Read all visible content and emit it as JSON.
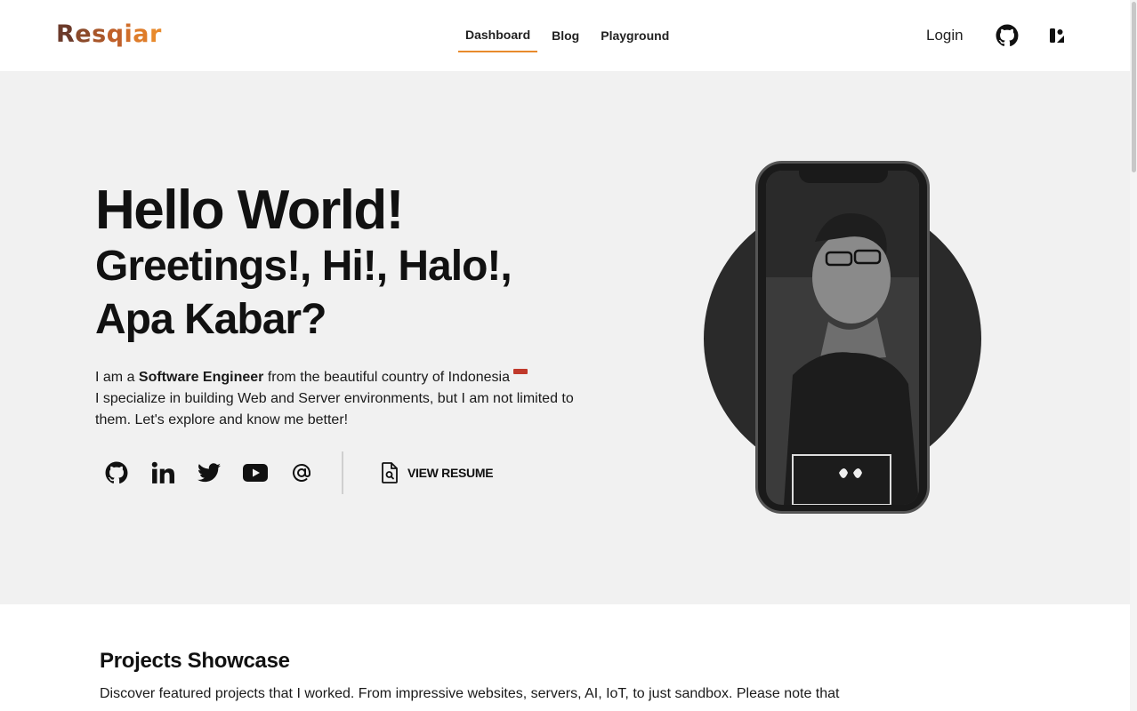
{
  "header": {
    "logo": [
      "R",
      "e",
      "s",
      "q",
      "i",
      "a",
      "r"
    ],
    "logo_colors": [
      "#6b3a2a",
      "#8b4a2a",
      "#a8562a",
      "#c0602a",
      "#d06e2a",
      "#de7c2a",
      "#e88a2c"
    ],
    "nav": [
      {
        "label": "Dashboard",
        "active": true
      },
      {
        "label": "Blog",
        "active": false
      },
      {
        "label": "Playground",
        "active": false
      }
    ],
    "login_label": "Login",
    "icons": [
      "github-icon",
      "theme-toggle-icon"
    ]
  },
  "hero": {
    "title": "Hello World!",
    "subtitle": "Greetings!, Hi!, Halo!, Apa Kabar?",
    "desc_prefix": "I am a ",
    "desc_bold": "Software Engineer",
    "desc_suffix": " from the beautiful country of Indonesia",
    "desc_line2": "I specialize in building Web and Server environments, but I am not limited to them. Let's explore and know me better!",
    "socials": [
      "github-icon",
      "linkedin-icon",
      "twitter-icon",
      "youtube-icon",
      "email-icon"
    ],
    "resume_label": "VIEW RESUME"
  },
  "projects": {
    "title": "Projects Showcase",
    "description": "Discover featured projects that I worked. From impressive websites, servers, AI, IoT, to just sandbox. Please note that"
  }
}
